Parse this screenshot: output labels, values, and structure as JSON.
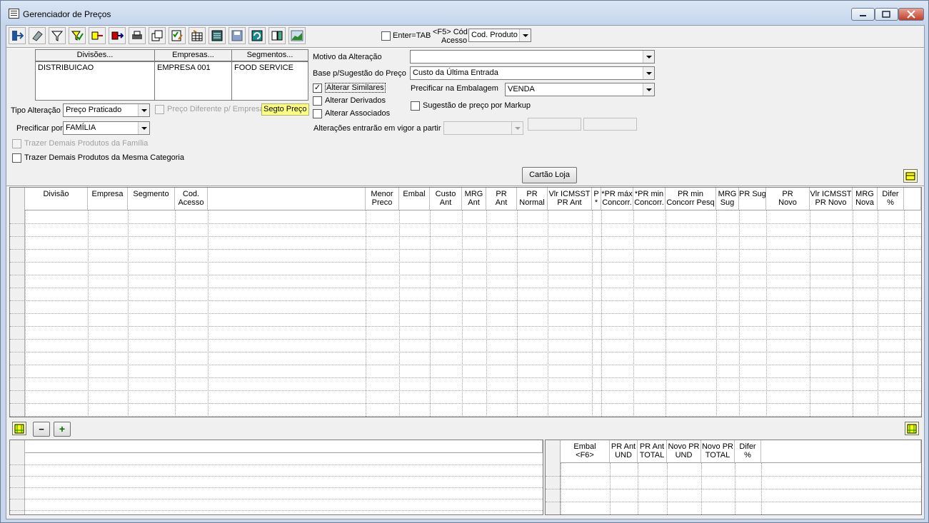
{
  "window": {
    "title": "Gerenciador de Preços",
    "min": "0",
    "max": "1",
    "close": "r"
  },
  "toolbar": {
    "buttons": [
      "exit-icon",
      "eraser-icon",
      "filter-icon",
      "filter-check-icon",
      "transfer-icon",
      "export-icon",
      "print-icon",
      "copy-icon",
      "checklist-icon",
      "grid-edit-icon",
      "sheet-icon",
      "save-icon",
      "refresh-icon",
      "compare-icon",
      "chart-icon"
    ],
    "enter_tab_label": "Enter=TAB",
    "f5_label_1": "<F5> Cód",
    "f5_label_2": "Acesso",
    "f5_value": "Cod. Produto"
  },
  "filters": {
    "divisoes_header": "Divisões...",
    "empresas_header": "Empresas...",
    "segmentos_header": "Segmentos...",
    "divisoes": [
      "DISTRIBUICAO"
    ],
    "empresas": [
      "EMPRESA 001"
    ],
    "segmentos": [
      "FOOD SERVICE"
    ],
    "tipo_alteracao_label": "Tipo Alteração",
    "tipo_alteracao_value": "Preço Praticado",
    "preco_diferente_label": "Preço Diferente p/ Empresa",
    "segto_preco_label": "Segto Preço",
    "precificar_por_label": "Precificar por",
    "precificar_por_value": "FAMÍLIA",
    "trazer_familia_label": "Trazer Demais Produtos da Família",
    "trazer_categoria_label": "Trazer Demais Produtos da Mesma Categoria"
  },
  "right_form": {
    "motivo_label": "Motivo da Alteração",
    "motivo_value": "",
    "base_label": "Base p/Sugestão do Preço",
    "base_value": "Custo da Última Entrada",
    "alterar_similares_label": "Alterar Similares",
    "alterar_similares_checked": "✓",
    "alterar_derivados_label": "Alterar Derivados",
    "alterar_associados_label": "Alterar Associados",
    "precificar_embalagem_label": "Precificar na Embalagem",
    "precificar_embalagem_value": "VENDA",
    "sugestao_markup_label": "Sugestão de preço por Markup",
    "vigor_label": "Alterações entrarão em vigor a partir",
    "cartao_loja_label": "Cartão Loja"
  },
  "main_grid": {
    "columns": [
      {
        "l1": "Divisão",
        "l2": ""
      },
      {
        "l1": "Empresa",
        "l2": ""
      },
      {
        "l1": "Segmento",
        "l2": ""
      },
      {
        "l1": "Cod.",
        "l2": "Acesso"
      },
      {
        "l1": "",
        "l2": ""
      },
      {
        "l1": "Menor",
        "l2": "Preco"
      },
      {
        "l1": "Embal",
        "l2": ""
      },
      {
        "l1": "Custo",
        "l2": "Ant"
      },
      {
        "l1": "MRG",
        "l2": "Ant"
      },
      {
        "l1": "PR",
        "l2": "Ant"
      },
      {
        "l1": "PR",
        "l2": "Normal"
      },
      {
        "l1": "Vlr ICMSST",
        "l2": "PR Ant"
      },
      {
        "l1": "P",
        "l2": "*"
      },
      {
        "l1": "*PR máx",
        "l2": "Concorr."
      },
      {
        "l1": "*PR min",
        "l2": "Concorr."
      },
      {
        "l1": "PR min",
        "l2": "Concorr Pesq"
      },
      {
        "l1": "MRG",
        "l2": "Sug"
      },
      {
        "l1": "PR Sug",
        "l2": ""
      },
      {
        "l1": "PR",
        "l2": "Novo"
      },
      {
        "l1": "Vlr ICMSST",
        "l2": "PR Novo"
      },
      {
        "l1": "MRG",
        "l2": "Nova"
      },
      {
        "l1": "Difer",
        "l2": "%"
      }
    ]
  },
  "grid_toolbar": {
    "minus": "−",
    "plus": "+"
  },
  "bottom_grid": {
    "columns": [
      {
        "l1": "Embal",
        "l2": "<F6>"
      },
      {
        "l1": "PR Ant",
        "l2": "UND"
      },
      {
        "l1": "PR Ant",
        "l2": "TOTAL"
      },
      {
        "l1": "Novo PR",
        "l2": "UND"
      },
      {
        "l1": "Novo PR",
        "l2": "TOTAL"
      },
      {
        "l1": "Difer",
        "l2": "%"
      }
    ]
  }
}
